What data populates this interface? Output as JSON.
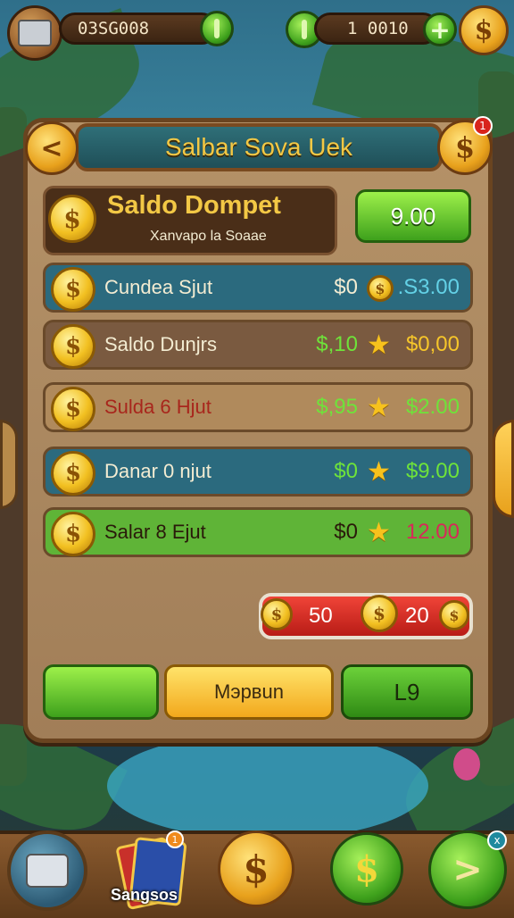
{
  "top_bar": {
    "coins_value": "0ЗSG008",
    "gems_value": "1   0010",
    "plus_label": "+",
    "coin_symbol": "$"
  },
  "panel": {
    "title": "Salbar Sova Uek",
    "back_label": "<",
    "notification_count": "1",
    "balance_title": "Saldo Dompet",
    "balance_subtitle": "Xanvapo la Soaae",
    "balance_button": "9.00"
  },
  "rows": [
    {
      "label": "Cundea Sjut",
      "value1": "$0",
      "icon": "coin-stack-icon",
      "value2": ".S3.00",
      "bg": "#2b6a7e",
      "label_color": "#f3ecd2",
      "v1_color": "#f3ecd2",
      "v2_color": "#63d1e6"
    },
    {
      "label": "Saldo Dunjrs",
      "value1": "$,10",
      "icon": "star-icon",
      "value2": "$0,00",
      "bg": "#7a5a40",
      "label_color": "#f3ecd2",
      "v1_color": "#6ee33a",
      "v2_color": "#f6c62a"
    },
    {
      "label": "Sulda 6 Hjut",
      "value1": "$,95",
      "icon": "star-icon",
      "value2": "$2.00",
      "bg": "#b08a5c",
      "label_color": "#a8261c",
      "v1_color": "#6ee33a",
      "v2_color": "#6ee33a"
    },
    {
      "label": "Danar 0 njut",
      "value1": "$0",
      "icon": "star-icon",
      "value2": "$9.00",
      "bg": "#2b6a7e",
      "label_color": "#f3ecd2",
      "v1_color": "#6ee33a",
      "v2_color": "#6ee33a"
    },
    {
      "label": "Salar 8 Ejut",
      "value1": "$0",
      "icon": "star-icon",
      "value2": "12.00",
      "bg": "#5fb437",
      "label_color": "#2a1a0a",
      "v1_color": "#2a1a0a",
      "v2_color": "#d8285a"
    }
  ],
  "bet_bar": {
    "left_value": "50",
    "right_value": "20"
  },
  "buttons": {
    "left_label": "",
    "middle_label": "Mэрвun",
    "right_label": "L9"
  },
  "bottom_bar": {
    "shop_label": "Sangsos",
    "shop_badge": "1",
    "close_badge": "x",
    "next_label": ">"
  },
  "colors": {
    "gold": "#f2c021",
    "green": "#5fb437",
    "wood": "#8a5a2e",
    "teal": "#2b6a7e"
  }
}
